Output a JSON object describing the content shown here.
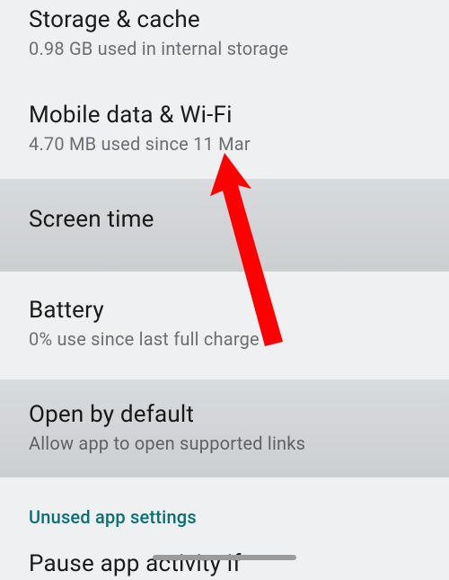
{
  "rows": [
    {
      "title": "Storage & cache",
      "sub": "0.98 GB used in internal storage"
    },
    {
      "title": "Mobile data & Wi-Fi",
      "sub": "4.70 MB used since 11 Mar"
    },
    {
      "title": "Screen time",
      "sub": ""
    },
    {
      "title": "Battery",
      "sub": "0% use since last full charge"
    },
    {
      "title": "Open by default",
      "sub": "Allow app to open supported links"
    }
  ],
  "section": "Unused app settings",
  "last": "Pause app activity if"
}
